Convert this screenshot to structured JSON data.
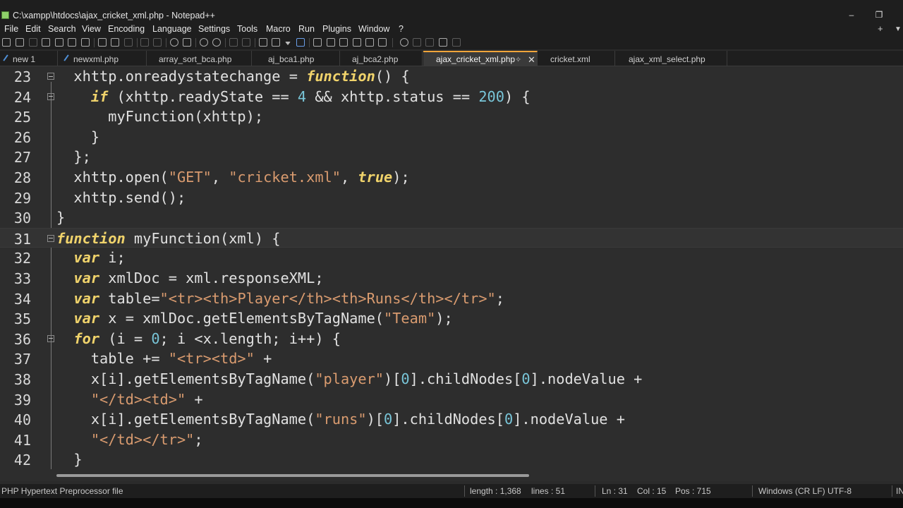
{
  "window": {
    "title": "C:\\xampp\\htdocs\\ajax_cricket_xml.php - Notepad++",
    "minimize": "–",
    "restore": "❐"
  },
  "menu": [
    "File",
    "Edit",
    "Search",
    "View",
    "Encoding",
    "Language",
    "Settings",
    "Tools",
    "Macro",
    "Run",
    "Plugins",
    "Window",
    "?"
  ],
  "menu_right": {
    "plus": "+",
    "dropdown": "▼"
  },
  "tabs": [
    {
      "label": "new 1"
    },
    {
      "label": "newxml.php"
    },
    {
      "label": "array_sort_bca.php"
    },
    {
      "label": "aj_bca1.php"
    },
    {
      "label": "aj_bca2.php"
    },
    {
      "label": "ajax_cricket_xml.php",
      "active": true,
      "pin": "✧",
      "close": "✕"
    },
    {
      "label": "cricket.xml"
    },
    {
      "label": "ajax_xml_select.php"
    }
  ],
  "code_lines": [
    {
      "num": "23",
      "fold": true,
      "tokens": [
        [
          "  ",
          "p"
        ],
        [
          "xhttp",
          "p"
        ],
        [
          ".onreadystatechange = ",
          "p"
        ],
        [
          "function",
          "k"
        ],
        [
          "() {",
          "p"
        ]
      ]
    },
    {
      "num": "24",
      "fold": true,
      "tokens": [
        [
          "    ",
          "p"
        ],
        [
          "if",
          "k"
        ],
        [
          " (xhttp.readyState == ",
          "p"
        ],
        [
          "4",
          "n"
        ],
        [
          " && xhttp.status == ",
          "p"
        ],
        [
          "200",
          "n"
        ],
        [
          ") {",
          "p"
        ]
      ]
    },
    {
      "num": "25",
      "tokens": [
        [
          "      myFunction(xhttp);",
          "p"
        ]
      ]
    },
    {
      "num": "26",
      "tokens": [
        [
          "    }",
          "p"
        ]
      ]
    },
    {
      "num": "27",
      "tokens": [
        [
          "  };",
          "p"
        ]
      ]
    },
    {
      "num": "28",
      "tokens": [
        [
          "  xhttp.open(",
          "p"
        ],
        [
          "\"GET\"",
          "s"
        ],
        [
          ", ",
          "p"
        ],
        [
          "\"cricket.xml\"",
          "s"
        ],
        [
          ", ",
          "p"
        ],
        [
          "true",
          "k"
        ],
        [
          ");",
          "p"
        ]
      ]
    },
    {
      "num": "29",
      "tokens": [
        [
          "  xhttp.send();",
          "p"
        ]
      ]
    },
    {
      "num": "30",
      "tokens": [
        [
          "}",
          "p"
        ]
      ]
    },
    {
      "num": "31",
      "fold": true,
      "current": true,
      "tokens": [
        [
          "function",
          "k"
        ],
        [
          " myFunction(xml) {",
          "p"
        ]
      ]
    },
    {
      "num": "32",
      "tokens": [
        [
          "  ",
          "p"
        ],
        [
          "var",
          "k"
        ],
        [
          " i;",
          "p"
        ]
      ]
    },
    {
      "num": "33",
      "tokens": [
        [
          "  ",
          "p"
        ],
        [
          "var",
          "k"
        ],
        [
          " xmlDoc = xml.responseXML;",
          "p"
        ]
      ]
    },
    {
      "num": "34",
      "tokens": [
        [
          "  ",
          "p"
        ],
        [
          "var",
          "k"
        ],
        [
          " table=",
          "p"
        ],
        [
          "\"<tr><th>Player</th><th>Runs</th></tr>\"",
          "s"
        ],
        [
          ";",
          "p"
        ]
      ]
    },
    {
      "num": "35",
      "tokens": [
        [
          "  ",
          "p"
        ],
        [
          "var",
          "k"
        ],
        [
          " x = xmlDoc.getElementsByTagName(",
          "p"
        ],
        [
          "\"Team\"",
          "s"
        ],
        [
          ");",
          "p"
        ]
      ]
    },
    {
      "num": "36",
      "fold": true,
      "tokens": [
        [
          "  ",
          "p"
        ],
        [
          "for",
          "k"
        ],
        [
          " (i = ",
          "p"
        ],
        [
          "0",
          "n"
        ],
        [
          "; i <x.length; i++) {",
          "p"
        ]
      ]
    },
    {
      "num": "37",
      "tokens": [
        [
          "    table += ",
          "p"
        ],
        [
          "\"<tr><td>\"",
          "s"
        ],
        [
          " +",
          "p"
        ]
      ]
    },
    {
      "num": "38",
      "tokens": [
        [
          "    x[i].getElementsByTagName(",
          "p"
        ],
        [
          "\"player\"",
          "s"
        ],
        [
          ")[",
          "p"
        ],
        [
          "0",
          "n"
        ],
        [
          "].childNodes[",
          "p"
        ],
        [
          "0",
          "n"
        ],
        [
          "].nodeValue +",
          "p"
        ]
      ]
    },
    {
      "num": "39",
      "tokens": [
        [
          "    ",
          "p"
        ],
        [
          "\"</td><td>\"",
          "s"
        ],
        [
          " +",
          "p"
        ]
      ]
    },
    {
      "num": "40",
      "tokens": [
        [
          "    x[i].getElementsByTagName(",
          "p"
        ],
        [
          "\"runs\"",
          "s"
        ],
        [
          ")[",
          "p"
        ],
        [
          "0",
          "n"
        ],
        [
          "].childNodes[",
          "p"
        ],
        [
          "0",
          "n"
        ],
        [
          "].nodeValue +",
          "p"
        ]
      ]
    },
    {
      "num": "41",
      "tokens": [
        [
          "    ",
          "p"
        ],
        [
          "\"</td></tr>\"",
          "s"
        ],
        [
          ";",
          "p"
        ]
      ]
    },
    {
      "num": "42",
      "tokens": [
        [
          "  }",
          "p"
        ]
      ]
    }
  ],
  "colors": {
    "k": "#f0d36b",
    "p": "#e0e0e0",
    "s": "#d99b6f",
    "n": "#79c6d9"
  },
  "status": {
    "file_type": "PHP Hypertext Preprocessor file",
    "length": "length : 1,368",
    "lines": "lines : 51",
    "ln": "Ln : 31",
    "col": "Col : 15",
    "pos": "Pos : 715",
    "eol_enc": "Windows (CR LF)  UTF-8",
    "ins": "IN"
  }
}
